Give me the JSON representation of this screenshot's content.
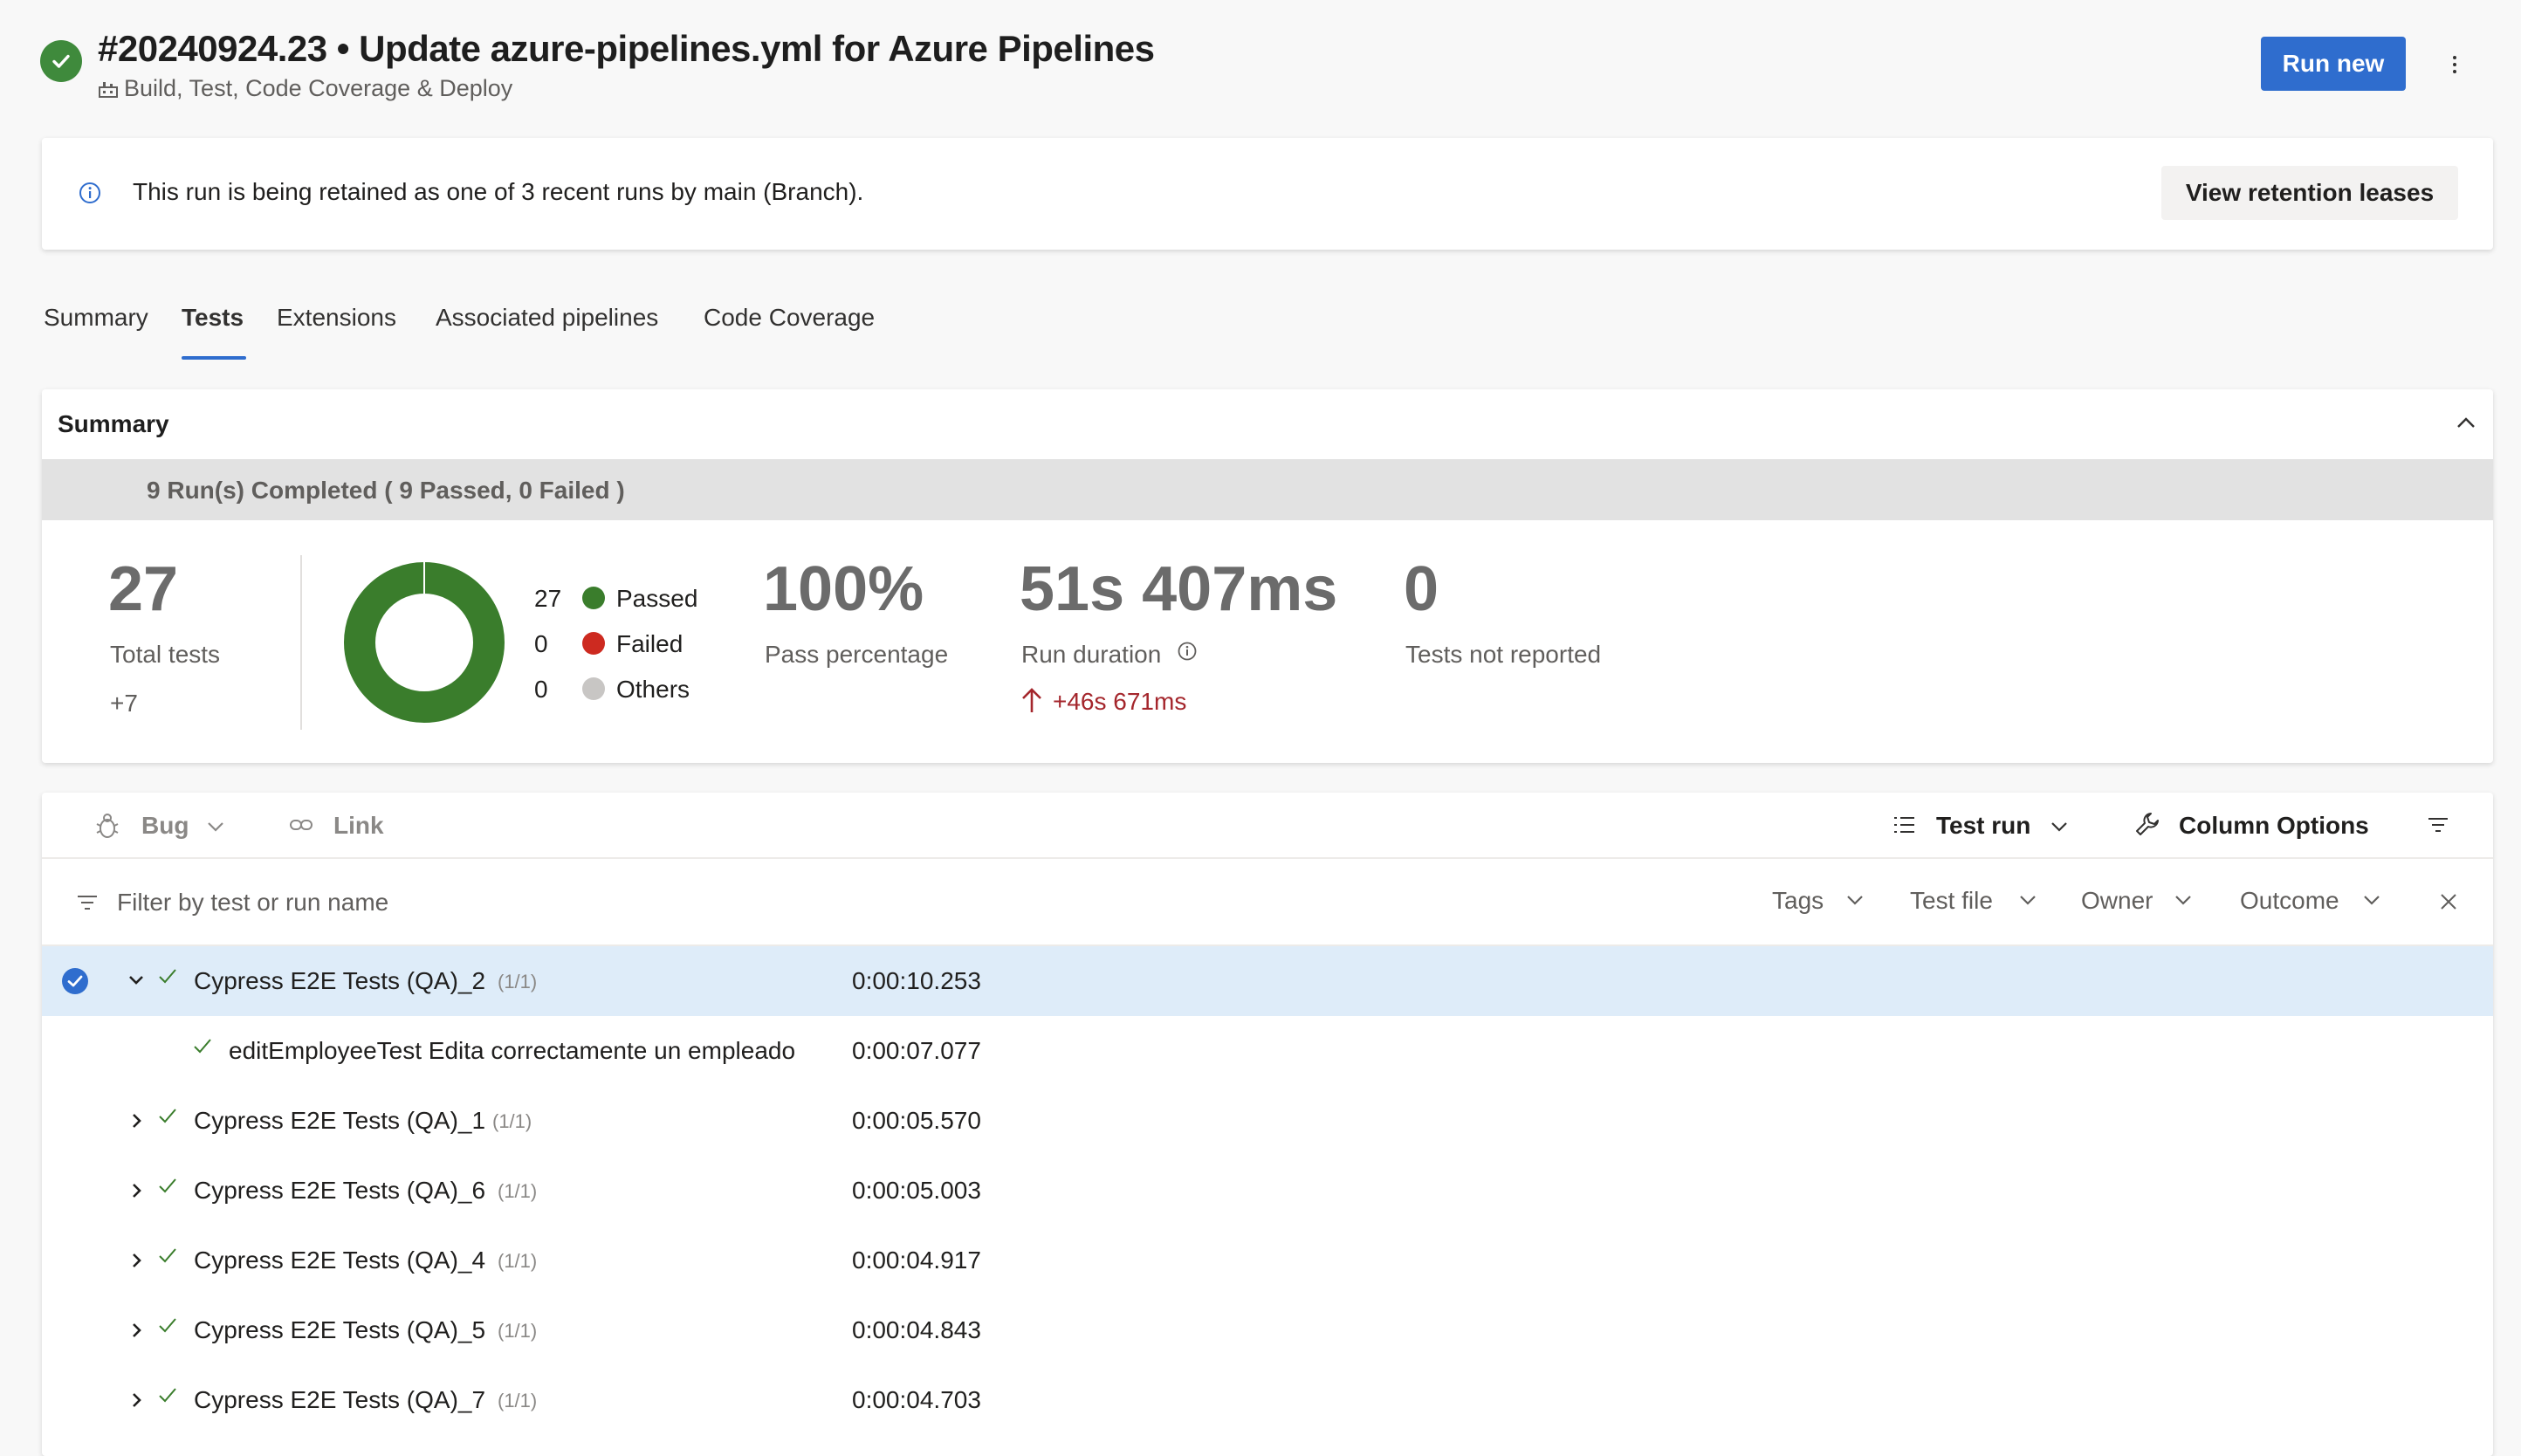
{
  "header": {
    "title": "#20240924.23 • Update azure-pipelines.yml for Azure Pipelines",
    "pipeline_name": "Build, Test, Code Coverage & Deploy",
    "run_new_label": "Run new",
    "status": "succeeded"
  },
  "banner": {
    "message": "This run is being retained as one of 3 recent runs by main (Branch).",
    "button_label": "View retention leases"
  },
  "tabs": [
    {
      "label": "Summary",
      "active": false
    },
    {
      "label": "Tests",
      "active": true
    },
    {
      "label": "Extensions",
      "active": false
    },
    {
      "label": "Associated pipelines",
      "active": false
    },
    {
      "label": "Code Coverage",
      "active": false
    }
  ],
  "summary": {
    "title": "Summary",
    "runs_completed": "9 Run(s) Completed ( 9 Passed, 0 Failed )",
    "total_tests": "27",
    "total_tests_label": "Total tests",
    "total_tests_delta": "+7",
    "legend": [
      {
        "count": "27",
        "label": "Passed",
        "color": "#3a7d2c"
      },
      {
        "count": "0",
        "label": "Failed",
        "color": "#cd2a20"
      },
      {
        "count": "0",
        "label": "Others",
        "color": "#c8c6c4"
      }
    ],
    "pass_percentage": "100%",
    "pass_percentage_label": "Pass percentage",
    "run_duration": "51s 407ms",
    "run_duration_label": "Run duration",
    "run_duration_delta": "+46s 671ms",
    "not_reported": "0",
    "not_reported_label": "Tests not reported"
  },
  "toolbar": {
    "bug_label": "Bug",
    "link_label": "Link",
    "test_run_label": "Test run",
    "column_options_label": "Column Options"
  },
  "filters": {
    "placeholder": "Filter by test or run name",
    "tags": "Tags",
    "test_file": "Test file",
    "owner": "Owner",
    "outcome": "Outcome"
  },
  "rows": [
    {
      "name": "Cypress E2E Tests (QA)_2",
      "count": "(1/1)",
      "duration": "0:00:10.253",
      "expanded": true,
      "selected": true
    },
    {
      "name": "editEmployeeTest Edita correctamente un empleado",
      "count": "",
      "duration": "0:00:07.077",
      "child": true
    },
    {
      "name": "Cypress E2E Tests (QA)_1",
      "count": "(1/1)",
      "duration": "0:00:05.570"
    },
    {
      "name": "Cypress E2E Tests (QA)_6",
      "count": "(1/1)",
      "duration": "0:00:05.003"
    },
    {
      "name": "Cypress E2E Tests (QA)_4",
      "count": "(1/1)",
      "duration": "0:00:04.917"
    },
    {
      "name": "Cypress E2E Tests (QA)_5",
      "count": "(1/1)",
      "duration": "0:00:04.843"
    },
    {
      "name": "Cypress E2E Tests (QA)_7",
      "count": "(1/1)",
      "duration": "0:00:04.703"
    }
  ]
}
